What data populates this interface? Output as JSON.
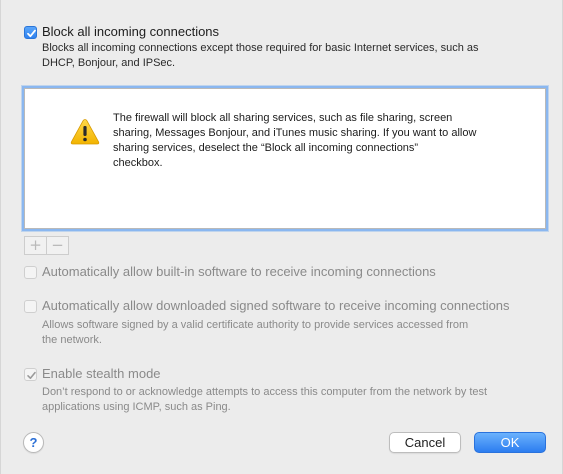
{
  "block_all": {
    "label": "Block all incoming connections",
    "checked": true,
    "description_line1": "Blocks all incoming connections except those required for basic Internet services, such as",
    "description_line2": "DHCP, Bonjour, and IPSec."
  },
  "warning": {
    "icon": "warning-triangle-icon",
    "line1": "The firewall will block all sharing services, such as file sharing, screen",
    "line2": "sharing, Messages Bonjour, and iTunes music sharing. If you want to allow",
    "line3": "sharing services, deselect the “Block all incoming connections”",
    "line4": "checkbox."
  },
  "list_controls": {
    "add": "+",
    "remove": "−"
  },
  "auto_builtin": {
    "label": "Automatically allow built-in software to receive incoming connections",
    "checked": false
  },
  "auto_signed": {
    "label": "Automatically allow downloaded signed software to receive incoming connections",
    "checked": false,
    "description_line1": "Allows software signed by a valid certificate authority to provide services accessed from",
    "description_line2": "the network."
  },
  "stealth": {
    "label": "Enable stealth mode",
    "checked": true,
    "description_line1": "Don’t respond to or acknowledge attempts to access this computer from the network by test",
    "description_line2": "applications using ICMP, such as Ping."
  },
  "footer": {
    "help": "?",
    "cancel": "Cancel",
    "ok": "OK"
  },
  "colors": {
    "accent": "#2f82f0",
    "focus_ring": "#8ab7f0",
    "disabled_text": "#8a8a8a"
  }
}
